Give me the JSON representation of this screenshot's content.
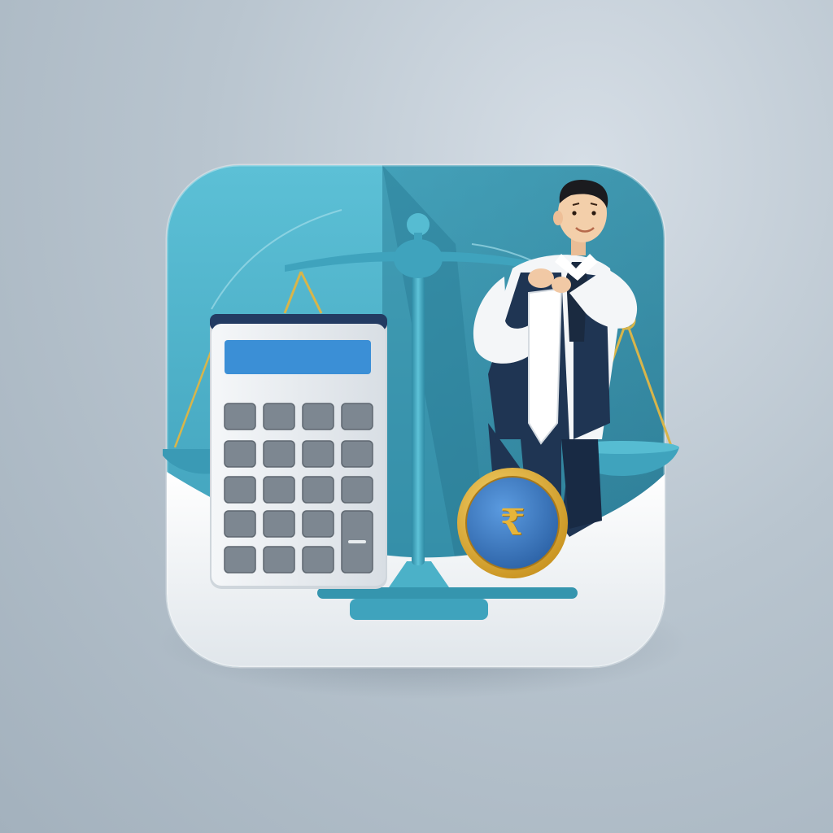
{
  "icon": {
    "name": "calculator-scale-accountant-app-icon",
    "colors": {
      "background": "#b9c5cf",
      "tile_teal": "#4db1c9",
      "tile_dark_teal": "#2a7f98",
      "tile_white": "#f2f5f8",
      "scale_teal": "#3fa3bd",
      "calculator_body": "#e9edf1",
      "calculator_screen": "#3b8fd6",
      "calculator_keys": "#7d8791",
      "coin_gold": "#e2b23a",
      "coin_blue": "#3f7fc4",
      "suit_navy": "#1f3553"
    },
    "elements": [
      "calculator-icon",
      "balance-scale-icon",
      "businessman-figure",
      "rupee-coin-icon"
    ],
    "coin": {
      "symbol": "₹"
    }
  }
}
